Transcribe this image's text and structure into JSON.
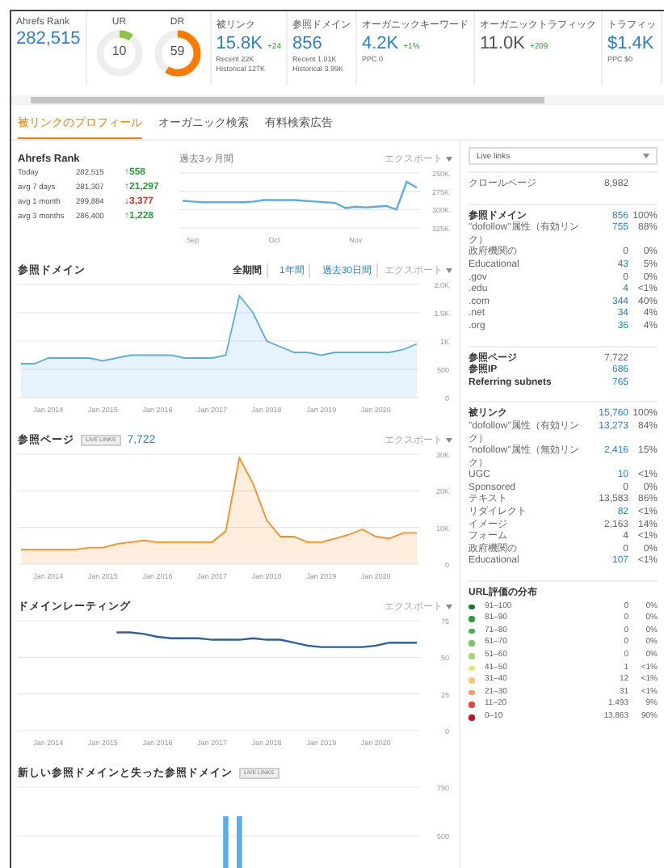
{
  "metrics": [
    {
      "kind": "value",
      "label": "Ahrefs Rank",
      "value": "282,515",
      "link": true
    },
    {
      "kind": "gauge",
      "label": "UR",
      "value": "10",
      "level": 0.1,
      "color": "#8bc34a"
    },
    {
      "kind": "gauge",
      "label": "DR",
      "value": "59",
      "level": 0.59,
      "color": "#ff7a00"
    },
    {
      "kind": "value",
      "label": "被リンク",
      "value": "15.8K",
      "link": true,
      "change": "+24",
      "notes": [
        "Recent 22K",
        "Historical 127K"
      ]
    },
    {
      "kind": "value",
      "label": "参照ドメイン",
      "value": "856",
      "link": true,
      "notes": [
        "Recent 1.01K",
        "Historical 3.99K"
      ]
    },
    {
      "kind": "value",
      "label": "オーガニックキーワード",
      "value": "4.2K",
      "link": true,
      "change": "+1%",
      "notes": [
        "PPC 0"
      ]
    },
    {
      "kind": "value",
      "label": "オーガニックトラフィック",
      "value": "11.0K",
      "link": false,
      "change": "+209"
    },
    {
      "kind": "value",
      "label": "トラフィッ",
      "value": "$1.4K",
      "link": true,
      "notes": [
        "PPC $0"
      ]
    }
  ],
  "tabs": [
    {
      "label": "被リンクのプロフィール",
      "selected": true
    },
    {
      "label": "オーガニック検索",
      "selected": false
    },
    {
      "label": "有料検索広告",
      "selected": false
    }
  ],
  "ahrefs_rank": {
    "title": "Ahrefs Rank",
    "rows": [
      {
        "period": "Today",
        "value": "282,515",
        "change": "↑558",
        "color": "#2e9a3e"
      },
      {
        "period": "avg 7 days",
        "value": "281,307",
        "change": "↑21,297",
        "color": "#2e9a3e"
      },
      {
        "period": "avg 1 month",
        "value": "299,884",
        "change": "↓3,377",
        "color": "#d32f2f"
      },
      {
        "period": "avg 3 months",
        "value": "286,400",
        "change": "↑1,228",
        "color": "#2e9a3e"
      }
    ],
    "chart_label": "過去3ヶ月間",
    "export": "エクスポート",
    "chart_data": {
      "type": "line",
      "grid": true,
      "categories": [
        null,
        "Sep",
        null,
        null,
        null,
        null,
        null,
        null,
        null,
        "Oct",
        null,
        null,
        null,
        null,
        null,
        null,
        null,
        "Nov",
        null,
        null,
        null,
        null,
        null,
        null
      ],
      "ylim": [
        325000,
        250000
      ],
      "yticks": [
        {
          "value": 250000,
          "label": "250K"
        },
        {
          "value": 275000,
          "label": "275K"
        },
        {
          "value": 300000,
          "label": "300K"
        },
        {
          "value": 325000,
          "label": "325K"
        }
      ],
      "series": [
        {
          "color": "#5aaee8",
          "values": [
            288000,
            289000,
            290000,
            290000,
            290000,
            290000,
            290000,
            289000,
            287000,
            287000,
            287000,
            287000,
            288000,
            289000,
            290000,
            291000,
            298000,
            296000,
            297000,
            296000,
            295000,
            300000,
            262000,
            270000
          ]
        }
      ]
    }
  },
  "referring_domains": {
    "title": "参照ドメイン",
    "ranges": [
      {
        "label": "全期間",
        "selected": true
      },
      {
        "label": "1年間",
        "selected": false
      },
      {
        "label": "過去30日間",
        "selected": false
      }
    ],
    "export": "エクスポート",
    "chart_data": {
      "type": "area",
      "grid": true,
      "categories": [
        null,
        null,
        "Jan 2014",
        null,
        null,
        null,
        "Jan 2015",
        null,
        null,
        null,
        "Jan 2016",
        null,
        null,
        null,
        "Jan 2017",
        null,
        null,
        null,
        "Jan 2018",
        null,
        null,
        null,
        "Jan 2019",
        null,
        null,
        null,
        "Jan 2020",
        null,
        null,
        null
      ],
      "ylim": [
        0,
        2000
      ],
      "yticks": [
        {
          "value": 0,
          "label": "0"
        },
        {
          "value": 500,
          "label": "500"
        },
        {
          "value": 1000,
          "label": "1K"
        },
        {
          "value": 1500,
          "label": "1.5K"
        },
        {
          "value": 2000,
          "label": "2.0K"
        }
      ],
      "series": [
        {
          "color": "#5aaee8",
          "values": [
            600,
            600,
            700,
            700,
            700,
            700,
            650,
            700,
            750,
            750,
            750,
            750,
            700,
            700,
            700,
            750,
            1800,
            1500,
            1000,
            900,
            800,
            800,
            750,
            800,
            800,
            800,
            800,
            800,
            850,
            950
          ]
        }
      ]
    }
  },
  "referring_pages": {
    "title": "参照ページ",
    "badge": "LIVE LINKS",
    "value": "7,722",
    "export": "エクスポート",
    "chart_data": {
      "type": "area",
      "grid": true,
      "categories": [
        null,
        null,
        "Jan 2014",
        null,
        null,
        null,
        "Jan 2015",
        null,
        null,
        null,
        "Jan 2016",
        null,
        null,
        null,
        "Jan 2017",
        null,
        null,
        null,
        "Jan 2018",
        null,
        null,
        null,
        "Jan 2019",
        null,
        null,
        null,
        "Jan 2020",
        null,
        null,
        null
      ],
      "ylim": [
        0,
        30000
      ],
      "yticks": [
        {
          "value": 0,
          "label": "0"
        },
        {
          "value": 10000,
          "label": "10K"
        },
        {
          "value": 20000,
          "label": "20K"
        },
        {
          "value": 30000,
          "label": "30K"
        }
      ],
      "series": [
        {
          "color": "#ff8c1a",
          "values": [
            4000,
            4000,
            4000,
            4000,
            4000,
            4500,
            4500,
            5500,
            6000,
            6500,
            6000,
            6000,
            6000,
            6000,
            6000,
            9000,
            29000,
            22000,
            12000,
            7500,
            7500,
            6000,
            6000,
            7000,
            8000,
            9500,
            7500,
            7000,
            8500,
            8500
          ]
        }
      ]
    }
  },
  "domain_rating": {
    "title": "ドメインレーティング",
    "export": "エクスポート",
    "chart_data": {
      "type": "line",
      "grid": true,
      "categories": [
        null,
        null,
        "Jan 2014",
        null,
        null,
        null,
        "Jan 2015",
        null,
        null,
        null,
        "Jan 2016",
        null,
        null,
        null,
        "Jan 2017",
        null,
        null,
        null,
        "Jan 2018",
        null,
        null,
        null,
        "Jan 2019",
        null,
        null,
        null,
        "Jan 2020",
        null,
        null,
        null
      ],
      "ylim": [
        0,
        75
      ],
      "yticks": [
        {
          "value": 0,
          "label": "0"
        },
        {
          "value": 25,
          "label": "25"
        },
        {
          "value": 50,
          "label": "50"
        },
        {
          "value": 75,
          "label": "75"
        }
      ],
      "series": [
        {
          "color": "#2b5fa6",
          "values": [
            null,
            null,
            null,
            null,
            null,
            null,
            null,
            67,
            67,
            66,
            64,
            63,
            63,
            63,
            62,
            62,
            62,
            63,
            62,
            62,
            60,
            58,
            57,
            57,
            57,
            57,
            58,
            60,
            60,
            60
          ]
        }
      ]
    }
  },
  "new_lost_domains": {
    "title": "新しい参照ドメインと失った参照ドメイン",
    "badge": "LIVE LINKS",
    "chart_data": {
      "type": "bar",
      "grid": true,
      "categories": [
        null,
        null,
        null,
        null,
        null,
        null,
        null,
        null,
        null,
        null,
        null,
        null,
        null,
        null,
        null,
        null,
        null,
        null,
        null,
        null,
        null,
        null,
        null,
        null,
        null,
        null,
        null,
        null,
        null,
        null
      ],
      "ylim": [
        0,
        750
      ],
      "yticks": [
        {
          "value": 500,
          "label": "500"
        },
        {
          "value": 750,
          "label": "750"
        }
      ],
      "series": [
        {
          "color": "#5aaee8",
          "values": [
            null,
            null,
            null,
            null,
            null,
            null,
            null,
            null,
            null,
            null,
            null,
            null,
            null,
            null,
            null,
            600,
            600,
            null,
            null,
            null,
            null,
            null,
            null,
            null,
            null,
            null,
            null,
            null,
            null,
            null
          ]
        }
      ]
    }
  },
  "sidebar": {
    "dropdown": "Live links",
    "groups": [
      {
        "rows": [
          {
            "label": "クロールページ",
            "value": "8,982",
            "link": false,
            "heading": false
          }
        ]
      },
      {
        "rows": [
          {
            "label": "参照ドメイン",
            "value": "856",
            "percent": "100%",
            "link": true,
            "heading": true
          },
          {
            "label": "\"dofollow\"属性（有効リンク）",
            "value": "755",
            "percent": "88%",
            "link": true,
            "heading": false
          },
          {
            "label": "政府機関の",
            "value": "0",
            "percent": "0%",
            "link": false,
            "heading": false
          },
          {
            "label": "Educational",
            "value": "43",
            "percent": "5%",
            "link": true,
            "heading": false
          },
          {
            "label": ".gov",
            "value": "0",
            "percent": "0%",
            "link": false,
            "heading": false
          },
          {
            "label": ".edu",
            "value": "4",
            "percent": "<1%",
            "link": true,
            "heading": false
          },
          {
            "label": ".com",
            "value": "344",
            "percent": "40%",
            "link": true,
            "heading": false
          },
          {
            "label": ".net",
            "value": "34",
            "percent": "4%",
            "link": true,
            "heading": false
          },
          {
            "label": ".org",
            "value": "36",
            "percent": "4%",
            "link": true,
            "heading": false
          }
        ]
      },
      {
        "rows": [
          {
            "label": "参照ページ",
            "value": "7,722",
            "link": false,
            "heading": true
          },
          {
            "label": "参照IP",
            "value": "686",
            "link": true,
            "heading": true
          },
          {
            "label": "Referring subnets",
            "value": "765",
            "link": true,
            "heading": true
          }
        ]
      },
      {
        "rows": [
          {
            "label": "被リンク",
            "value": "15,760",
            "percent": "100%",
            "link": true,
            "heading": true
          },
          {
            "label": "\"dofollow\"属性（有効リンク）",
            "value": "13,273",
            "percent": "84%",
            "link": true,
            "heading": false
          },
          {
            "label": "\"nofollow\"属性（無効リンク）",
            "value": "2,416",
            "percent": "15%",
            "link": true,
            "heading": false
          },
          {
            "label": "UGC",
            "value": "10",
            "percent": "<1%",
            "link": true,
            "heading": false
          },
          {
            "label": "Sponsored",
            "value": "0",
            "percent": "0%",
            "link": false,
            "heading": false
          },
          {
            "label": "テキスト",
            "value": "13,583",
            "percent": "86%",
            "link": false,
            "heading": false
          },
          {
            "label": "リダイレクト",
            "value": "82",
            "percent": "<1%",
            "link": true,
            "heading": false
          },
          {
            "label": "イメージ",
            "value": "2,163",
            "percent": "14%",
            "link": false,
            "heading": false
          },
          {
            "label": "フォーム",
            "value": "4",
            "percent": "<1%",
            "link": false,
            "heading": false
          },
          {
            "label": "政府機関の",
            "value": "0",
            "percent": "0%",
            "link": false,
            "heading": false
          },
          {
            "label": "Educational",
            "value": "107",
            "percent": "<1%",
            "link": true,
            "heading": false
          }
        ]
      }
    ],
    "rating_distribution": {
      "title": "URL評価の分布",
      "rows": [
        {
          "range": "91–100",
          "color": "#1b7a2e",
          "count": "0",
          "percent": "0%"
        },
        {
          "range": "81–90",
          "color": "#2e9a3e",
          "count": "0",
          "percent": "0%"
        },
        {
          "range": "71–80",
          "color": "#4caf50",
          "count": "0",
          "percent": "0%"
        },
        {
          "range": "61–70",
          "color": "#7cc36a",
          "count": "0",
          "percent": "0%"
        },
        {
          "range": "51–60",
          "color": "#a8d66e",
          "count": "0",
          "percent": "0%"
        },
        {
          "range": "41–50",
          "color": "#e6e27a",
          "count": "1",
          "percent": "<1%"
        },
        {
          "range": "31–40",
          "color": "#f7c873",
          "count": "12",
          "percent": "<1%"
        },
        {
          "range": "21–30",
          "color": "#f59b5b",
          "count": "31",
          "percent": "<1%"
        },
        {
          "range": "11–20",
          "color": "#e8473c",
          "count": "1,493",
          "percent": "9%"
        },
        {
          "range": "0–10",
          "color": "#c2102a",
          "count": "13,863",
          "percent": "90%"
        }
      ]
    }
  }
}
